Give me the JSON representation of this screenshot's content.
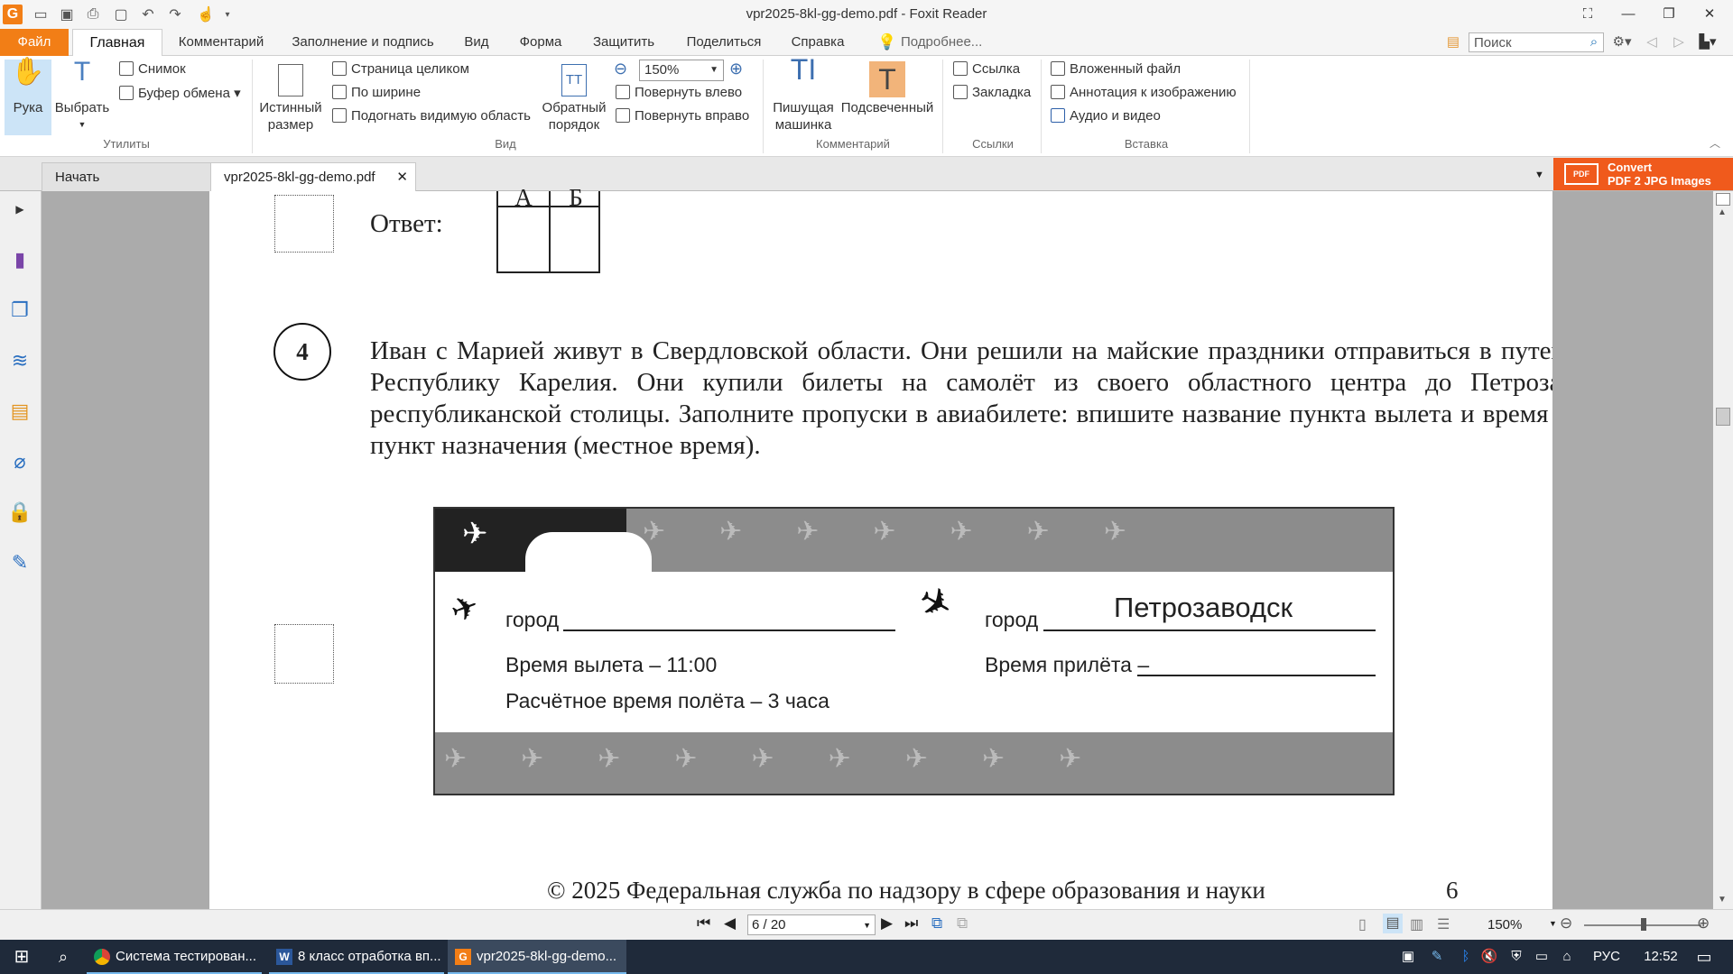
{
  "window": {
    "title": "vpr2025-8kl-gg-demo.pdf - Foxit Reader"
  },
  "menu": {
    "file": "Файл",
    "tabs": [
      "Главная",
      "Комментарий",
      "Заполнение и подпись",
      "Вид",
      "Форма",
      "Защитить",
      "Поделиться",
      "Справка"
    ],
    "tell_me": "Подробнее...",
    "search_placeholder": "Поиск"
  },
  "ribbon": {
    "hand": "Рука",
    "select": "Выбрать",
    "snapshot": "Снимок",
    "clipboard": "Буфер обмена",
    "group_utilities": "Утилиты",
    "actual_size_1": "Истинный",
    "actual_size_2": "размер",
    "fit_page": "Страница целиком",
    "fit_width": "По ширине",
    "fit_visible": "Подогнать видимую область",
    "reverse_1": "Обратный",
    "reverse_2": "порядок",
    "zoom": "150%",
    "rotate_left": "Повернуть влево",
    "rotate_right": "Повернуть вправо",
    "group_view": "Вид",
    "typewriter_1": "Пишущая",
    "typewriter_2": "машинка",
    "highlight": "Подсвеченный",
    "group_comment": "Комментарий",
    "link": "Ссылка",
    "bookmark": "Закладка",
    "group_links": "Ссылки",
    "attach": "Вложенный файл",
    "image_annot": "Аннотация к изображению",
    "audio_video": "Аудио и видео",
    "group_insert": "Вставка"
  },
  "tabs": {
    "start": "Начать",
    "doc": "vpr2025-8kl-gg-demo.pdf",
    "convert_1": "Convert",
    "convert_2": "PDF 2 JPG Images"
  },
  "document": {
    "answer_label": "Ответ:",
    "answer_cols": [
      "А",
      "Б"
    ],
    "task_number": "4",
    "task_text": "Иван с Марией живут в Свердловской области. Они решили на майские праздники отправиться в путешествие в Республику Карелия. Они купили билеты на самолёт из своего областного центра до Петрозаводска – республиканской столицы. Заполните пропуски в авиабилете: впишите название пункта вылета и время прилёта в пункт назначения (местное время).",
    "ticket": {
      "city_label": "город",
      "destination": "Петрозаводск",
      "departure_time": "Время вылета – 11:00",
      "flight_time": "Расчётное время полёта – 3 часа",
      "arrival_time": "Время прилёта –"
    },
    "footer": "© 2025 Федеральная служба по надзору в сфере образования и науки",
    "page_num": "6"
  },
  "navigation": {
    "page": "6 / 20",
    "zoom": "150%"
  },
  "taskbar": {
    "apps": [
      "Система тестирован...",
      "8 класс отработка вп...",
      "vpr2025-8kl-gg-demo..."
    ],
    "lang": "РУС",
    "time": "12:52"
  }
}
